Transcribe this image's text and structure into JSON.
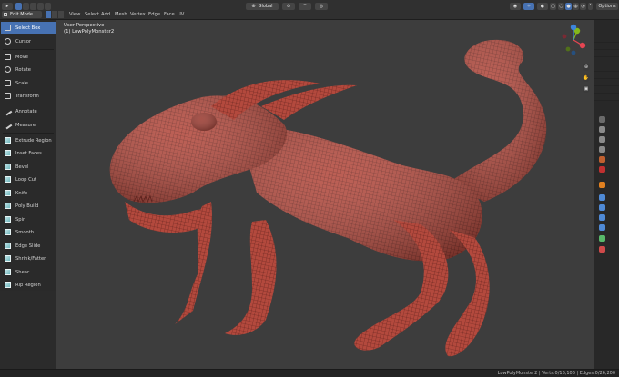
{
  "header": {
    "orientation": "Global",
    "options_label": "Options",
    "menu": [
      "View",
      "Select",
      "Add",
      "Mesh",
      "Vertex",
      "Edge",
      "Face",
      "UV"
    ],
    "mode": "Edit Mode"
  },
  "toolbar": {
    "tools": [
      {
        "label": "Select Box",
        "active": true,
        "icon": "select-box-icon"
      },
      {
        "label": "Cursor",
        "icon": "cursor-icon"
      },
      {
        "label": "Move",
        "icon": "move-icon"
      },
      {
        "label": "Rotate",
        "icon": "rotate-icon"
      },
      {
        "label": "Scale",
        "icon": "scale-icon"
      },
      {
        "label": "Transform",
        "icon": "transform-icon"
      },
      {
        "label": "Annotate",
        "icon": "annotate-icon"
      },
      {
        "label": "Measure",
        "icon": "measure-icon"
      },
      {
        "label": "Extrude Region",
        "icon": "extrude-icon"
      },
      {
        "label": "Inset Faces",
        "icon": "inset-icon"
      },
      {
        "label": "Bevel",
        "icon": "bevel-icon"
      },
      {
        "label": "Loop Cut",
        "icon": "loop-cut-icon"
      },
      {
        "label": "Knife",
        "icon": "knife-icon"
      },
      {
        "label": "Poly Build",
        "icon": "poly-build-icon"
      },
      {
        "label": "Spin",
        "icon": "spin-icon"
      },
      {
        "label": "Smooth",
        "icon": "smooth-icon"
      },
      {
        "label": "Edge Slide",
        "icon": "edge-slide-icon"
      },
      {
        "label": "Shrink/Fatten",
        "icon": "shrink-fatten-icon"
      },
      {
        "label": "Shear",
        "icon": "shear-icon"
      },
      {
        "label": "Rip Region",
        "icon": "rip-region-icon"
      }
    ]
  },
  "viewport": {
    "view_name": "User Perspective",
    "object_name": "(1) LowPolyMonster2"
  },
  "status": {
    "text": "LowPolyMonster2 | Verts:0/16,106 | Edges:0/26,200"
  },
  "gizmo": {
    "axes": [
      "X",
      "Y",
      "Z"
    ],
    "colors": {
      "x": "#e64552",
      "y": "#84b91a",
      "z": "#3c85dd"
    }
  },
  "colors": {
    "accent": "#4772b3",
    "mesh": "#b04a3e",
    "viewport_bg": "#3d3d3d"
  }
}
